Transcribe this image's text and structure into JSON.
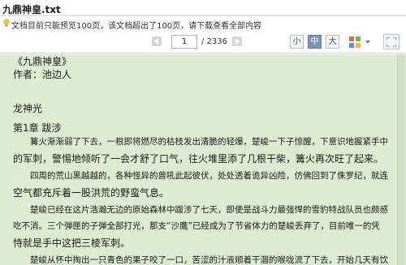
{
  "window": {
    "title": "九鼎神皇.txt"
  },
  "notice": {
    "text": "文档目前只能预览100页，该文档超出了100页，请下载查看全部内容"
  },
  "toolbar": {
    "current_page": "1",
    "total_pages": "/ 2336",
    "font_sizes": [
      {
        "label": "小",
        "active": false
      },
      {
        "label": "中",
        "active": true
      },
      {
        "label": "大",
        "active": false
      }
    ]
  },
  "document": {
    "lines": [
      "《九鼎神皇》",
      "作者：池边人",
      "",
      "龙神光",
      "第1章 跋涉",
      "　　篝火渐渐弱了下去，一根即将燃尽的枯枝发出清脆的轻爆，楚峻一下子惊醒，下意识地握紧手中",
      "的军刺，警惕地倾听了一会才舒了口气，往火堆里添了几根干柴，篝火再次旺了起来。",
      "　　四周的荒山黑越越的，各种怪异的兽吼此起彼伏，处处透着诡异凶险，仿佛回到了侏罗纪，就连",
      "空气都充斥着一股洪荒的野蛮气息。",
      "　　楚峻已经在这片浩瀚无边的原始森林中跋涉了七天，即使是战斗力最强悍的雪豹特战队员也颇感",
      "吃不消。三个弹匣的子弹全部打光，那支“沙鹰”已经成为了节省体力的楚峻丢弃了，目前唯一的凭",
      "恃就是手中这把三棱军刺。",
      "　　楚峻从怀中掏出一只青色的果子咬了一口，苦涩的汁液顺着干涸的喉咙流了下去，开始几天有饮"
    ]
  },
  "colors": {
    "content_background": "#dcebd1",
    "active_button": "#7e95b2"
  },
  "icons": {
    "notice": "lightbulb-icon",
    "prev": "prev-page-icon",
    "next": "next-page-icon",
    "view": "grid-view-icon",
    "fullscreen": "fullscreen-icon"
  }
}
